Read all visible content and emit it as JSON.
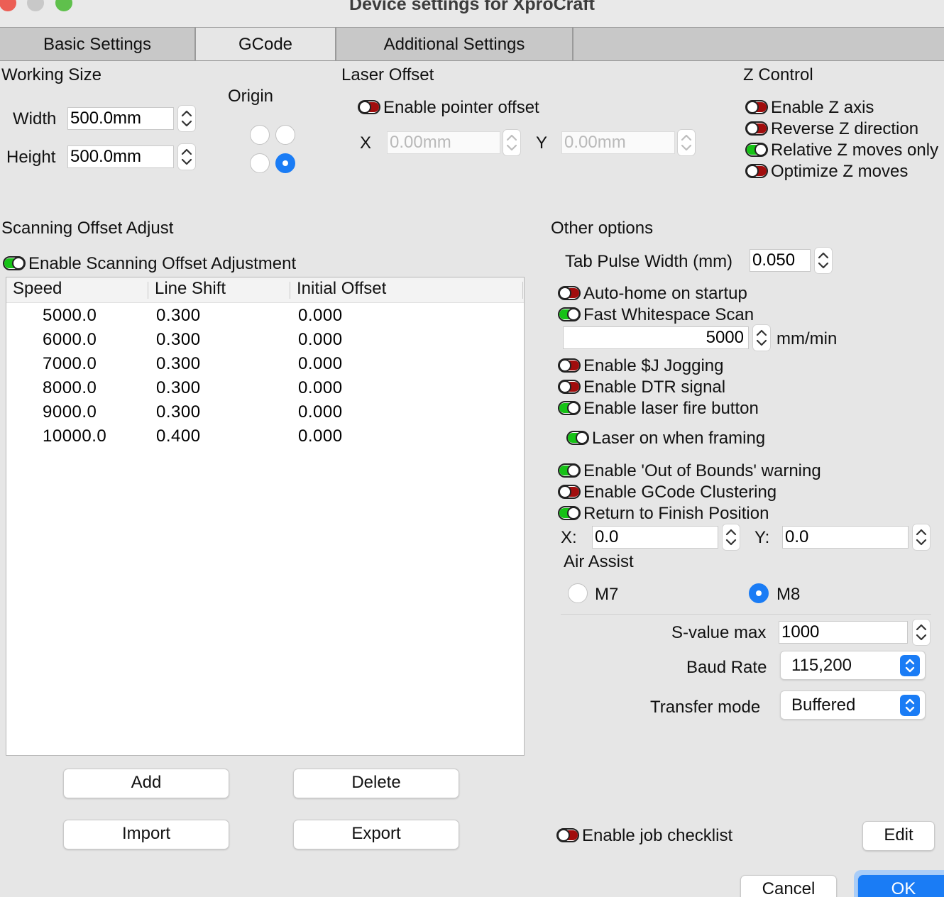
{
  "window": {
    "title": "Device settings for XproCraft"
  },
  "tabs": [
    {
      "label": "Basic Settings"
    },
    {
      "label": "GCode"
    },
    {
      "label": "Additional Settings"
    }
  ],
  "working_size": {
    "heading": "Working Size",
    "width_label": "Width",
    "width_value": "500.0mm",
    "height_label": "Height",
    "height_value": "500.0mm"
  },
  "origin": {
    "heading": "Origin",
    "selected": "bottom-right"
  },
  "laser_offset": {
    "heading": "Laser Offset",
    "enable_label": "Enable pointer offset",
    "enabled": false,
    "x_label": "X",
    "x_value": "0.00mm",
    "y_label": "Y",
    "y_value": "0.00mm"
  },
  "z_control": {
    "heading": "Z Control",
    "items": [
      {
        "label": "Enable Z axis",
        "on": false
      },
      {
        "label": "Reverse Z direction",
        "on": false
      },
      {
        "label": "Relative Z moves only",
        "on": true
      },
      {
        "label": "Optimize Z moves",
        "on": false
      }
    ]
  },
  "scanning": {
    "heading": "Scanning Offset Adjust",
    "enable_label": "Enable Scanning Offset Adjustment",
    "enabled": true,
    "columns": [
      "Speed",
      "Line Shift",
      "Initial Offset"
    ],
    "rows": [
      [
        "5000.0",
        "0.300",
        "0.000"
      ],
      [
        "6000.0",
        "0.300",
        "0.000"
      ],
      [
        "7000.0",
        "0.300",
        "0.000"
      ],
      [
        "8000.0",
        "0.300",
        "0.000"
      ],
      [
        "9000.0",
        "0.300",
        "0.000"
      ],
      [
        "10000.0",
        "0.400",
        "0.000"
      ]
    ],
    "add_label": "Add",
    "delete_label": "Delete",
    "import_label": "Import",
    "export_label": "Export"
  },
  "other": {
    "heading": "Other options",
    "tab_pulse_label": "Tab Pulse Width (mm)",
    "tab_pulse_value": "0.050",
    "auto_home": {
      "label": "Auto-home on startup",
      "on": false
    },
    "fast_ws": {
      "label": "Fast Whitespace Scan",
      "on": true
    },
    "ws_speed_value": "5000",
    "ws_speed_unit": "mm/min",
    "jogging": {
      "label": "Enable $J Jogging",
      "on": false
    },
    "dtr": {
      "label": "Enable DTR signal",
      "on": false
    },
    "fire_button": {
      "label": "Enable laser fire button",
      "on": true
    },
    "laser_framing": {
      "label": "Laser on when framing",
      "on": true
    },
    "oob": {
      "label": "Enable 'Out of Bounds' warning",
      "on": true
    },
    "clustering": {
      "label": "Enable GCode Clustering",
      "on": false
    },
    "return_finish": {
      "label": "Return to Finish Position",
      "on": true
    },
    "finish_x_label": "X:",
    "finish_x_value": "0.0",
    "finish_y_label": "Y:",
    "finish_y_value": "0.0",
    "air_assist_heading": "Air Assist",
    "air_m7": "M7",
    "air_m8": "M8",
    "air_selected": "M8",
    "svalue_label": "S-value max",
    "svalue_value": "1000",
    "baud_label": "Baud Rate",
    "baud_value": "115,200",
    "transfer_label": "Transfer mode",
    "transfer_value": "Buffered",
    "checklist": {
      "label": "Enable job checklist",
      "on": false
    },
    "edit_label": "Edit"
  },
  "footer": {
    "cancel_label": "Cancel",
    "ok_label": "OK"
  },
  "colors": {
    "toggle_on": "#16c216",
    "toggle_off": "#a10d0d",
    "accent": "#1a7cf5",
    "traffic_red": "#ec5e55",
    "traffic_gray": "#c8c8c8",
    "traffic_green": "#5fc04c"
  }
}
